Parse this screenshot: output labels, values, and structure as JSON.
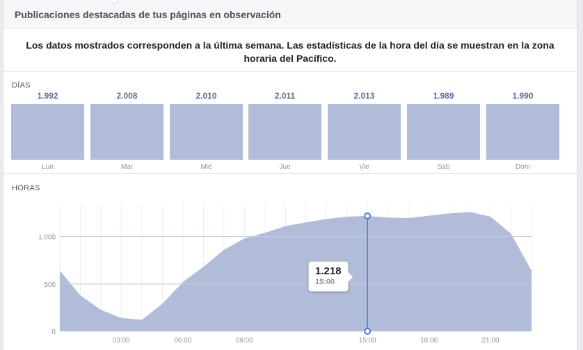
{
  "header": {
    "title": "Publicaciones destacadas de tus páginas en observación"
  },
  "note": "Los datos mostrados corresponden a la última semana. Las estadísticas de la hora del día se muestran en la zona horaria del Pacífico.",
  "colors": {
    "bar": "#b0bcd8",
    "area": "#b0bcd8",
    "cursor": "#4a76e8",
    "grid": "#e5e7eb"
  },
  "days": {
    "label": "DÍAS",
    "items": [
      {
        "name": "Lun",
        "value": "1.992",
        "num": 1992
      },
      {
        "name": "Mar",
        "value": "2.008",
        "num": 2008
      },
      {
        "name": "Mié",
        "value": "2.010",
        "num": 2010
      },
      {
        "name": "Jue",
        "value": "2.011",
        "num": 2011
      },
      {
        "name": "Vie",
        "value": "2.013",
        "num": 2013
      },
      {
        "name": "Sáb",
        "value": "1.989",
        "num": 1989
      },
      {
        "name": "Dom",
        "value": "1.990",
        "num": 1990
      }
    ]
  },
  "hours": {
    "label": "HORAS",
    "tooltip": {
      "value": "1.218",
      "time": "15:00"
    }
  },
  "chart_data": [
    {
      "type": "bar",
      "categories": [
        "Lun",
        "Mar",
        "Mié",
        "Jue",
        "Vie",
        "Sáb",
        "Dom"
      ],
      "values": [
        1992,
        2008,
        2010,
        2011,
        2013,
        1989,
        1990
      ]
    },
    {
      "type": "area",
      "x": [
        0,
        1,
        2,
        3,
        4,
        5,
        6,
        7,
        8,
        9,
        10,
        11,
        12,
        13,
        14,
        15,
        16,
        17,
        18,
        19,
        20,
        21,
        22,
        23
      ],
      "values": [
        640,
        380,
        225,
        140,
        120,
        290,
        520,
        680,
        860,
        980,
        1040,
        1110,
        1150,
        1185,
        1210,
        1218,
        1200,
        1195,
        1220,
        1245,
        1260,
        1210,
        1030,
        640
      ],
      "xticks": [
        "03:00",
        "06:00",
        "09:00",
        "15:00",
        "18:00",
        "21:00"
      ],
      "xtick_hours": [
        3,
        6,
        9,
        15,
        18,
        21
      ],
      "yticks": [
        "0",
        "500",
        "1.000"
      ],
      "ytick_values": [
        0,
        500,
        1000
      ],
      "ylim": [
        0,
        1320
      ],
      "highlight": {
        "x": 15,
        "value": 1218
      }
    }
  ]
}
